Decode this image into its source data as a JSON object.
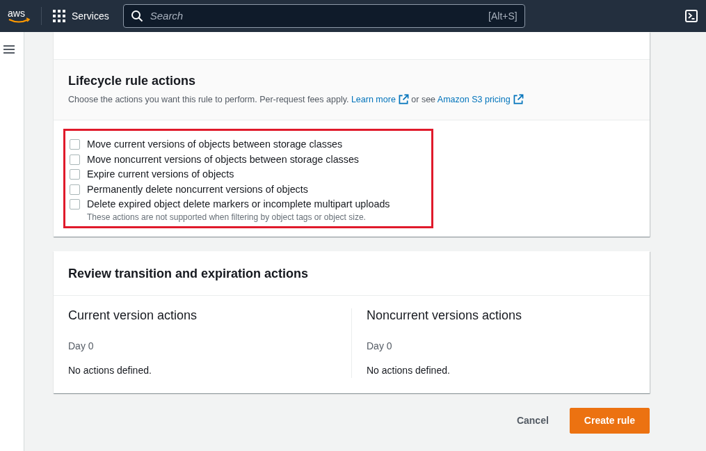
{
  "top_nav": {
    "logo_text": "aws",
    "services_label": "Services",
    "search": {
      "placeholder": "Search",
      "shortcut": "[Alt+S]"
    }
  },
  "lifecycle_actions": {
    "title": "Lifecycle rule actions",
    "description": [
      {
        "kind": "text",
        "text": "Choose the actions you want this rule to perform. Per-request fees apply. "
      },
      {
        "kind": "link",
        "text": "Learn more"
      },
      {
        "kind": "text",
        "text": " or see "
      },
      {
        "kind": "link",
        "text": "Amazon S3 pricing"
      }
    ],
    "highlighted": true,
    "options": [
      {
        "label": "Move current versions of objects between storage classes",
        "checked": false
      },
      {
        "label": "Move noncurrent versions of objects between storage classes",
        "checked": false
      },
      {
        "label": "Expire current versions of objects",
        "checked": false
      },
      {
        "label": "Permanently delete noncurrent versions of objects",
        "checked": false
      },
      {
        "label": "Delete expired object delete markers or incomplete multipart uploads",
        "checked": false,
        "hint": "These actions are not supported when filtering by object tags or object size."
      }
    ]
  },
  "review": {
    "title": "Review transition and expiration actions",
    "columns": [
      {
        "title": "Current version actions",
        "day": "Day 0",
        "message": "No actions defined."
      },
      {
        "title": "Noncurrent versions actions",
        "day": "Day 0",
        "message": "No actions defined."
      }
    ]
  },
  "buttons": [
    {
      "label": "Cancel",
      "kind": "link"
    },
    {
      "label": "Create rule",
      "kind": "primary"
    }
  ]
}
